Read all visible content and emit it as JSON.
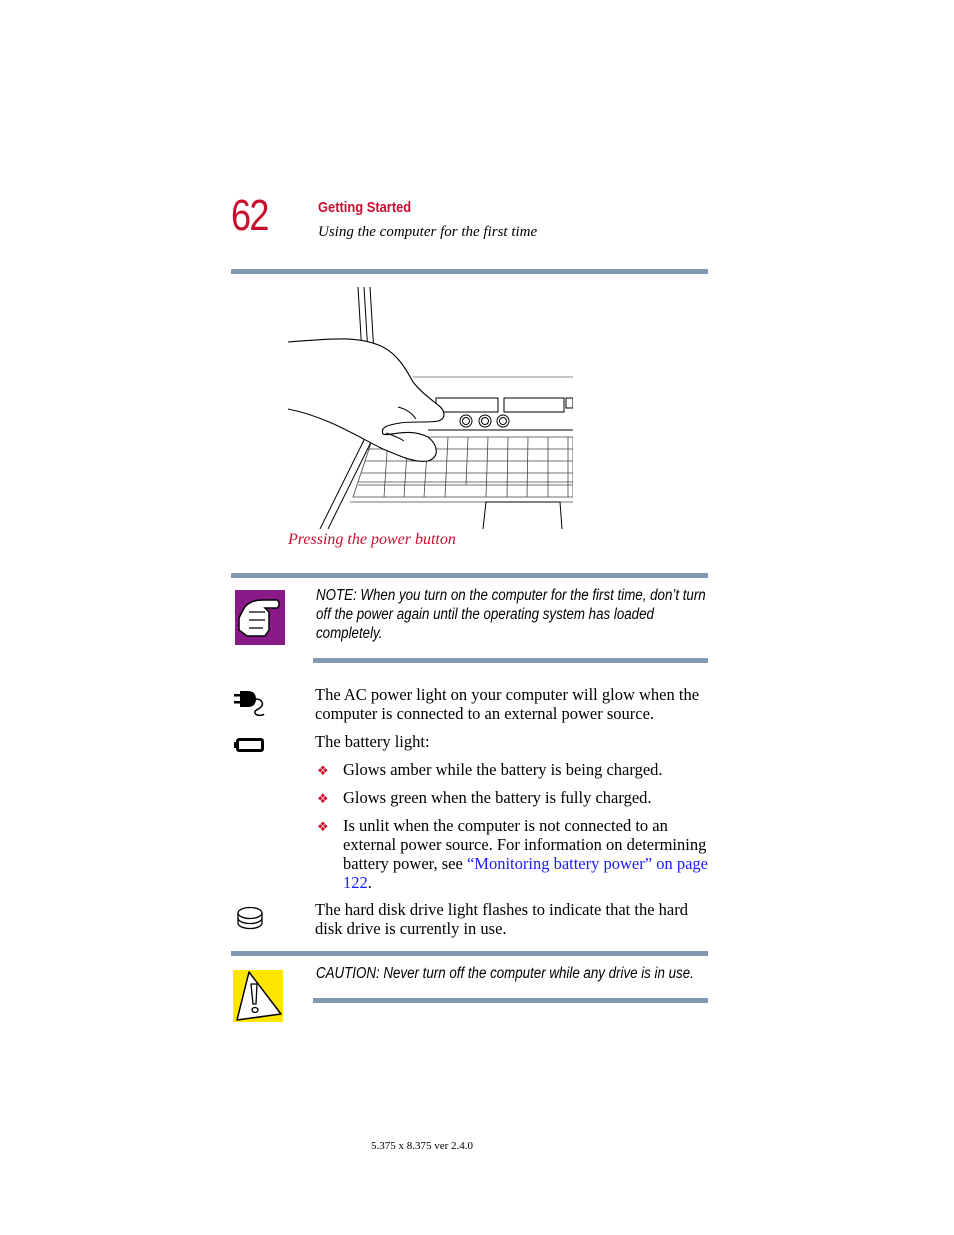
{
  "header": {
    "page_number": "62",
    "chapter_title": "Getting Started",
    "section_title": "Using the computer for the first time"
  },
  "figure": {
    "caption": "Pressing the power button",
    "illustration": "hand-pressing-power-button-illustration"
  },
  "note": {
    "icon": "pointing-hand-icon",
    "icon_color": "#8b1a89",
    "text": "NOTE: When you turn on the computer for the first time, don’t turn off the power again until the operating system has loaded completely."
  },
  "items": [
    {
      "icon": "ac-power-plug-icon",
      "text": "The AC power light on your computer will glow when the computer is connected to an external power source."
    },
    {
      "icon": "battery-icon",
      "text": "The battery light:",
      "bullets": [
        "Glows amber while the battery is being charged.",
        "Glows green when the battery is fully charged.",
        {
          "text_before": "Is unlit when the computer is not connected to an external power source. For information on determining battery power, see ",
          "link": "“Monitoring battery power” on page 122",
          "text_after": "."
        }
      ]
    },
    {
      "icon": "hard-disk-icon",
      "text": "The hard disk drive light flashes to indicate that the hard disk drive is currently in use."
    }
  ],
  "caution": {
    "icon": "warning-triangle-icon",
    "icon_color": "#ffe600",
    "text": "CAUTION: Never turn off the computer while any drive is in use."
  },
  "footer": {
    "text": "5.375 x 8.375 ver 2.4.0"
  },
  "colors": {
    "accent_red": "#c8102e",
    "rule_blue": "#8199b1",
    "link_blue": "#1a1aff"
  }
}
